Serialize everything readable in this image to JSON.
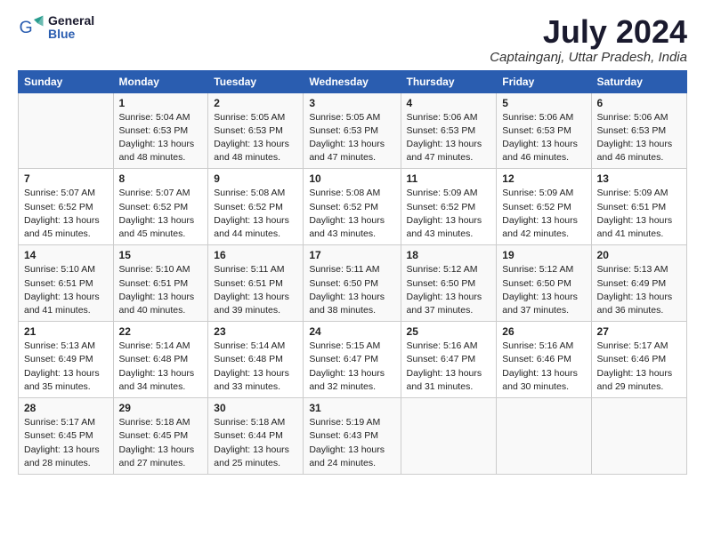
{
  "logo": {
    "line1": "General",
    "line2": "Blue"
  },
  "title": "July 2024",
  "subtitle": "Captainganj, Uttar Pradesh, India",
  "days_of_week": [
    "Sunday",
    "Monday",
    "Tuesday",
    "Wednesday",
    "Thursday",
    "Friday",
    "Saturday"
  ],
  "weeks": [
    [
      {
        "num": "",
        "text": ""
      },
      {
        "num": "1",
        "text": "Sunrise: 5:04 AM\nSunset: 6:53 PM\nDaylight: 13 hours\nand 48 minutes."
      },
      {
        "num": "2",
        "text": "Sunrise: 5:05 AM\nSunset: 6:53 PM\nDaylight: 13 hours\nand 48 minutes."
      },
      {
        "num": "3",
        "text": "Sunrise: 5:05 AM\nSunset: 6:53 PM\nDaylight: 13 hours\nand 47 minutes."
      },
      {
        "num": "4",
        "text": "Sunrise: 5:06 AM\nSunset: 6:53 PM\nDaylight: 13 hours\nand 47 minutes."
      },
      {
        "num": "5",
        "text": "Sunrise: 5:06 AM\nSunset: 6:53 PM\nDaylight: 13 hours\nand 46 minutes."
      },
      {
        "num": "6",
        "text": "Sunrise: 5:06 AM\nSunset: 6:53 PM\nDaylight: 13 hours\nand 46 minutes."
      }
    ],
    [
      {
        "num": "7",
        "text": "Sunrise: 5:07 AM\nSunset: 6:52 PM\nDaylight: 13 hours\nand 45 minutes."
      },
      {
        "num": "8",
        "text": "Sunrise: 5:07 AM\nSunset: 6:52 PM\nDaylight: 13 hours\nand 45 minutes."
      },
      {
        "num": "9",
        "text": "Sunrise: 5:08 AM\nSunset: 6:52 PM\nDaylight: 13 hours\nand 44 minutes."
      },
      {
        "num": "10",
        "text": "Sunrise: 5:08 AM\nSunset: 6:52 PM\nDaylight: 13 hours\nand 43 minutes."
      },
      {
        "num": "11",
        "text": "Sunrise: 5:09 AM\nSunset: 6:52 PM\nDaylight: 13 hours\nand 43 minutes."
      },
      {
        "num": "12",
        "text": "Sunrise: 5:09 AM\nSunset: 6:52 PM\nDaylight: 13 hours\nand 42 minutes."
      },
      {
        "num": "13",
        "text": "Sunrise: 5:09 AM\nSunset: 6:51 PM\nDaylight: 13 hours\nand 41 minutes."
      }
    ],
    [
      {
        "num": "14",
        "text": "Sunrise: 5:10 AM\nSunset: 6:51 PM\nDaylight: 13 hours\nand 41 minutes."
      },
      {
        "num": "15",
        "text": "Sunrise: 5:10 AM\nSunset: 6:51 PM\nDaylight: 13 hours\nand 40 minutes."
      },
      {
        "num": "16",
        "text": "Sunrise: 5:11 AM\nSunset: 6:51 PM\nDaylight: 13 hours\nand 39 minutes."
      },
      {
        "num": "17",
        "text": "Sunrise: 5:11 AM\nSunset: 6:50 PM\nDaylight: 13 hours\nand 38 minutes."
      },
      {
        "num": "18",
        "text": "Sunrise: 5:12 AM\nSunset: 6:50 PM\nDaylight: 13 hours\nand 37 minutes."
      },
      {
        "num": "19",
        "text": "Sunrise: 5:12 AM\nSunset: 6:50 PM\nDaylight: 13 hours\nand 37 minutes."
      },
      {
        "num": "20",
        "text": "Sunrise: 5:13 AM\nSunset: 6:49 PM\nDaylight: 13 hours\nand 36 minutes."
      }
    ],
    [
      {
        "num": "21",
        "text": "Sunrise: 5:13 AM\nSunset: 6:49 PM\nDaylight: 13 hours\nand 35 minutes."
      },
      {
        "num": "22",
        "text": "Sunrise: 5:14 AM\nSunset: 6:48 PM\nDaylight: 13 hours\nand 34 minutes."
      },
      {
        "num": "23",
        "text": "Sunrise: 5:14 AM\nSunset: 6:48 PM\nDaylight: 13 hours\nand 33 minutes."
      },
      {
        "num": "24",
        "text": "Sunrise: 5:15 AM\nSunset: 6:47 PM\nDaylight: 13 hours\nand 32 minutes."
      },
      {
        "num": "25",
        "text": "Sunrise: 5:16 AM\nSunset: 6:47 PM\nDaylight: 13 hours\nand 31 minutes."
      },
      {
        "num": "26",
        "text": "Sunrise: 5:16 AM\nSunset: 6:46 PM\nDaylight: 13 hours\nand 30 minutes."
      },
      {
        "num": "27",
        "text": "Sunrise: 5:17 AM\nSunset: 6:46 PM\nDaylight: 13 hours\nand 29 minutes."
      }
    ],
    [
      {
        "num": "28",
        "text": "Sunrise: 5:17 AM\nSunset: 6:45 PM\nDaylight: 13 hours\nand 28 minutes."
      },
      {
        "num": "29",
        "text": "Sunrise: 5:18 AM\nSunset: 6:45 PM\nDaylight: 13 hours\nand 27 minutes."
      },
      {
        "num": "30",
        "text": "Sunrise: 5:18 AM\nSunset: 6:44 PM\nDaylight: 13 hours\nand 25 minutes."
      },
      {
        "num": "31",
        "text": "Sunrise: 5:19 AM\nSunset: 6:43 PM\nDaylight: 13 hours\nand 24 minutes."
      },
      {
        "num": "",
        "text": ""
      },
      {
        "num": "",
        "text": ""
      },
      {
        "num": "",
        "text": ""
      }
    ]
  ]
}
